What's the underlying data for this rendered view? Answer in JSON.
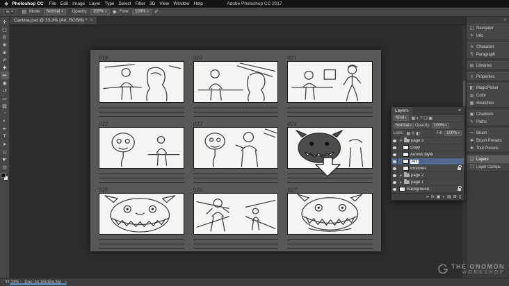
{
  "colors": {
    "selection": "#52688a",
    "scroll_thumb": "#5d84b4",
    "artboard_gray": "#585858"
  },
  "menu_bar": {
    "apple_icon": "❖",
    "app_name": "Photoshop CC",
    "items": [
      "File",
      "Edit",
      "Image",
      "Layer",
      "Type",
      "Select",
      "Filter",
      "3D",
      "View",
      "Window",
      "Help"
    ],
    "window_title": "Adobe Photoshop CC 2017"
  },
  "options_bar": {
    "tool_icon": "✏",
    "panel_toggle_icon": "▤",
    "mode_label": "Mode:",
    "mode_value": "Normal",
    "opacity_label": "Opacity:",
    "opacity_value": "100%",
    "pressure_icon": "◉",
    "flow_label": "Flow:",
    "flow_value": "100%",
    "airbrush_icon": "✐"
  },
  "document_tab": {
    "title": "Cantina.psd @ 33.3% (Art, RGB/8) *",
    "close_icon": "×"
  },
  "toolbar": {
    "tools": [
      {
        "name": "move-tool",
        "glyph": "✛"
      },
      {
        "name": "marquee-tool",
        "glyph": "▢"
      },
      {
        "name": "lasso-tool",
        "glyph": "ϱ"
      },
      {
        "name": "quick-selection-tool",
        "glyph": "❋"
      },
      {
        "name": "crop-tool",
        "glyph": "⊞"
      },
      {
        "name": "eyedropper-tool",
        "glyph": "✐"
      },
      {
        "name": "healing-brush-tool",
        "glyph": "✚"
      },
      {
        "name": "brush-tool",
        "glyph": "✏",
        "active": true
      },
      {
        "name": "clone-stamp-tool",
        "glyph": "◉"
      },
      {
        "name": "history-brush-tool",
        "glyph": "↺"
      },
      {
        "name": "eraser-tool",
        "glyph": "▭"
      },
      {
        "name": "gradient-tool",
        "glyph": "▧"
      },
      {
        "name": "blur-tool",
        "glyph": "◔"
      },
      {
        "name": "dodge-tool",
        "glyph": "◐"
      },
      {
        "name": "pen-tool",
        "glyph": "✒"
      },
      {
        "name": "type-tool",
        "glyph": "T"
      },
      {
        "name": "path-selection-tool",
        "glyph": "➤"
      },
      {
        "name": "shape-tool",
        "glyph": "◻"
      },
      {
        "name": "hand-tool",
        "glyph": "☛"
      },
      {
        "name": "zoom-tool",
        "glyph": "◎"
      }
    ]
  },
  "right_dock": {
    "collapse_icon": "«",
    "groups": [
      [
        {
          "label": "Navigator",
          "glyph": "◱"
        },
        {
          "label": "Info",
          "glyph": "✛"
        }
      ],
      [
        {
          "label": "Character",
          "glyph": "A"
        },
        {
          "label": "Paragraph",
          "glyph": "¶"
        }
      ],
      [
        {
          "label": "Libraries",
          "glyph": "▤"
        }
      ],
      [
        {
          "label": "Properties",
          "glyph": "≡"
        }
      ],
      [
        {
          "label": "MagicPicker",
          "glyph": "◧"
        },
        {
          "label": "Color",
          "glyph": "▥"
        },
        {
          "label": "Swatches",
          "glyph": "▦"
        }
      ],
      [
        {
          "label": "Channels",
          "glyph": "▣"
        },
        {
          "label": "Paths",
          "glyph": "✎"
        }
      ],
      [
        {
          "label": "Brush",
          "glyph": "✑"
        },
        {
          "label": "Brush Presets",
          "glyph": "✱"
        },
        {
          "label": "Tool Presets",
          "glyph": "✚"
        }
      ],
      [
        {
          "label": "Layers",
          "glyph": "❏",
          "selected": true
        },
        {
          "label": "Layer Comps",
          "glyph": "❐"
        }
      ]
    ]
  },
  "layers_panel": {
    "title": "Layers",
    "panel_menu_icon": "≡",
    "filter_label": "Kind",
    "filter_icons": "▦ ◐ T ❏ ▣",
    "blend_mode": "Normal",
    "opacity_label": "Opacity:",
    "opacity_value": "100%",
    "lock_label": "Lock:",
    "lock_icons": "▦ ✛ ◧",
    "fill_label": "Fill:",
    "fill_value": "100%",
    "layers": [
      {
        "name": "page 3",
        "kind": "group",
        "expanded": true,
        "eye": true
      },
      {
        "name": "Copy",
        "kind": "layer",
        "depth": 1,
        "eye": true
      },
      {
        "name": "Arrows layer",
        "kind": "layer",
        "depth": 1,
        "eye": true
      },
      {
        "name": "Art",
        "kind": "layer",
        "depth": 1,
        "eye": true,
        "selected": true
      },
      {
        "name": "Enemies",
        "kind": "layer",
        "depth": 1,
        "eye": true,
        "locked": true
      },
      {
        "name": "page 2",
        "kind": "group",
        "eye": true
      },
      {
        "name": "page 1",
        "kind": "group",
        "eye": true
      },
      {
        "name": "Background",
        "kind": "layer",
        "eye": true,
        "locked": true
      }
    ],
    "footer_icons": [
      {
        "name": "link-layers-icon",
        "glyph": "∞"
      },
      {
        "name": "layer-effects-icon",
        "glyph": "fx"
      },
      {
        "name": "layer-mask-icon",
        "glyph": "▣"
      },
      {
        "name": "adjustment-layer-icon",
        "glyph": "◐"
      },
      {
        "name": "new-group-icon",
        "glyph": "▤"
      },
      {
        "name": "new-layer-icon",
        "glyph": "⊞"
      },
      {
        "name": "delete-layer-icon",
        "glyph": "▯"
      }
    ]
  },
  "storyboard": {
    "panels": [
      {
        "number": "019",
        "sketch": "bar-couple"
      },
      {
        "number": "020",
        "sketch": "bar-action"
      },
      {
        "number": "021",
        "sketch": "bar-standing"
      },
      {
        "number": "022",
        "sketch": "alien-closeup"
      },
      {
        "number": "023",
        "sketch": "alien-grab"
      },
      {
        "number": "024",
        "sketch": "gargoyle-dark"
      },
      {
        "number": "025",
        "sketch": "monster-grin"
      },
      {
        "number": "026",
        "sketch": "walk-scene"
      },
      {
        "number": "027",
        "sketch": "monster-grin-2"
      }
    ]
  },
  "status_bar": {
    "zoom": "33.33%",
    "doc": "Doc: 34.1M/184.3M",
    "chevron": ">"
  },
  "watermark": {
    "line1": "THE GNOMON",
    "line2": "WORKSHOP"
  }
}
